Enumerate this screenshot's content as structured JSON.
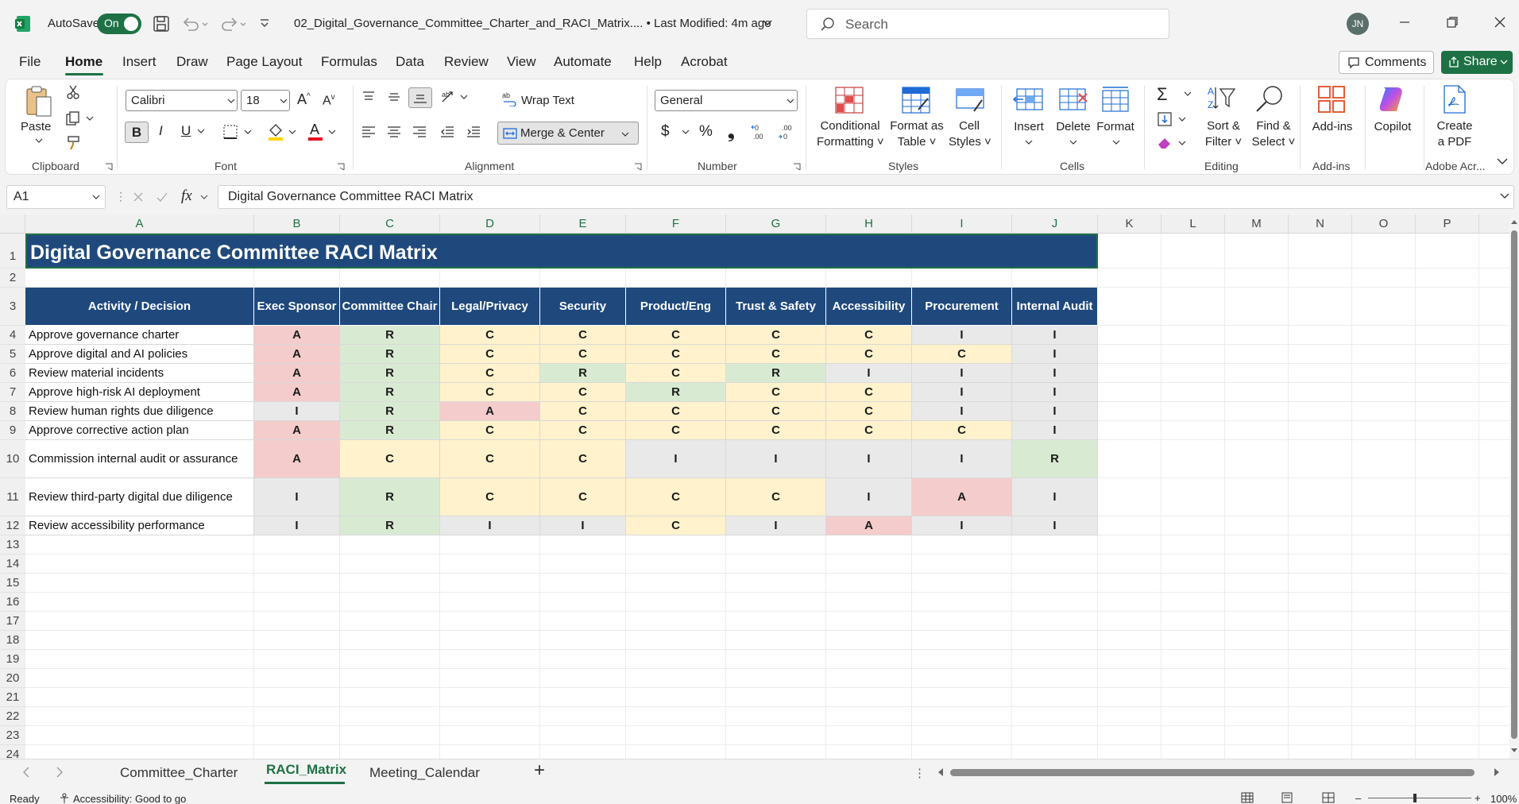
{
  "titlebar": {
    "autosave_label": "AutoSave",
    "autosave_state": "On",
    "file_name": "02_Digital_Governance_Committee_Charter_and_RACI_Matrix....",
    "dot": "•",
    "last_modified": "Last Modified: 4m ago",
    "search_placeholder": "Search",
    "user_initials": "JN"
  },
  "menu": {
    "items": [
      "File",
      "Home",
      "Insert",
      "Draw",
      "Page Layout",
      "Formulas",
      "Data",
      "Review",
      "View",
      "Automate",
      "Help",
      "Acrobat"
    ],
    "active": "Home",
    "comments_label": "Comments",
    "share_label": "Share"
  },
  "ribbon": {
    "clipboard": {
      "paste": "Paste",
      "group": "Clipboard"
    },
    "font": {
      "family": "Calibri",
      "size": "18",
      "group": "Font"
    },
    "alignment": {
      "wrap_text": "Wrap Text",
      "merge_center": "Merge & Center",
      "group": "Alignment"
    },
    "number": {
      "format": "General",
      "group": "Number",
      "currency": "$",
      "percent": "%",
      "comma": "❟"
    },
    "styles": {
      "conditional_1": "Conditional",
      "conditional_2": "Formatting",
      "format_table_1": "Format as",
      "format_table_2": "Table",
      "cell_styles_1": "Cell",
      "cell_styles_2": "Styles",
      "group": "Styles"
    },
    "cells": {
      "insert": "Insert",
      "delete": "Delete",
      "format": "Format",
      "group": "Cells"
    },
    "editing": {
      "sort_1": "Sort &",
      "sort_2": "Filter",
      "find_1": "Find &",
      "find_2": "Select",
      "group": "Editing"
    },
    "addins": {
      "label": "Add-ins",
      "group": "Add-ins"
    },
    "copilot": {
      "label": "Copilot"
    },
    "acrobat": {
      "create_1": "Create",
      "create_2": "a PDF",
      "group": "Adobe Acr..."
    }
  },
  "formula_bar": {
    "name_box": "A1",
    "fx": "fx",
    "content": "Digital Governance Committee RACI Matrix"
  },
  "sheet": {
    "columns": [
      "A",
      "B",
      "C",
      "D",
      "E",
      "F",
      "G",
      "H",
      "I",
      "J",
      "K",
      "L",
      "M",
      "N",
      "O",
      "P"
    ],
    "rows": [
      "1",
      "2",
      "3",
      "4",
      "5",
      "6",
      "7",
      "8",
      "9",
      "10",
      "11",
      "12",
      "13",
      "14",
      "15",
      "16",
      "17",
      "18",
      "19",
      "20",
      "21",
      "22",
      "23",
      "24"
    ],
    "title": "Digital Governance Committee RACI Matrix",
    "headers": [
      "Activity / Decision",
      "Exec Sponsor",
      "Committee Chair",
      "Legal/Privacy",
      "Security",
      "Product/Eng",
      "Trust & Safety",
      "Accessibility",
      "Procurement",
      "Internal Audit"
    ],
    "matrix": [
      {
        "activity": "Approve governance charter",
        "roles": [
          "A",
          "R",
          "C",
          "C",
          "C",
          "C",
          "C",
          "I",
          "I"
        ]
      },
      {
        "activity": "Approve digital and AI policies",
        "roles": [
          "A",
          "R",
          "C",
          "C",
          "C",
          "C",
          "C",
          "C",
          "I"
        ]
      },
      {
        "activity": "Review material incidents",
        "roles": [
          "A",
          "R",
          "C",
          "R",
          "C",
          "R",
          "I",
          "I",
          "I"
        ]
      },
      {
        "activity": "Approve high-risk AI deployment",
        "roles": [
          "A",
          "R",
          "C",
          "C",
          "R",
          "C",
          "C",
          "I",
          "I"
        ]
      },
      {
        "activity": "Review human rights due diligence",
        "roles": [
          "I",
          "R",
          "A",
          "C",
          "C",
          "C",
          "C",
          "I",
          "I"
        ]
      },
      {
        "activity": "Approve corrective action plan",
        "roles": [
          "A",
          "R",
          "C",
          "C",
          "C",
          "C",
          "C",
          "C",
          "I"
        ]
      },
      {
        "activity": "Commission internal audit or assurance",
        "roles": [
          "A",
          "C",
          "C",
          "C",
          "I",
          "I",
          "I",
          "I",
          "R"
        ]
      },
      {
        "activity": "Review third-party digital due diligence",
        "roles": [
          "I",
          "R",
          "C",
          "C",
          "C",
          "C",
          "I",
          "A",
          "I"
        ]
      },
      {
        "activity": "Review accessibility performance",
        "roles": [
          "I",
          "R",
          "I",
          "I",
          "C",
          "I",
          "A",
          "I",
          "I"
        ]
      }
    ]
  },
  "colors": {
    "header_bg": "#1f497d",
    "R": "#d9ead3",
    "A": "#f4cccc",
    "C": "#fff2cc",
    "I": "#e9e9ea",
    "accent": "#1e7145"
  },
  "tabs": {
    "items": [
      "Committee_Charter",
      "RACI_Matrix",
      "Meeting_Calendar"
    ],
    "active": "RACI_Matrix",
    "add": "+"
  },
  "status": {
    "ready": "Ready",
    "accessibility": "Accessibility: Good to go",
    "zoom": "100%"
  }
}
